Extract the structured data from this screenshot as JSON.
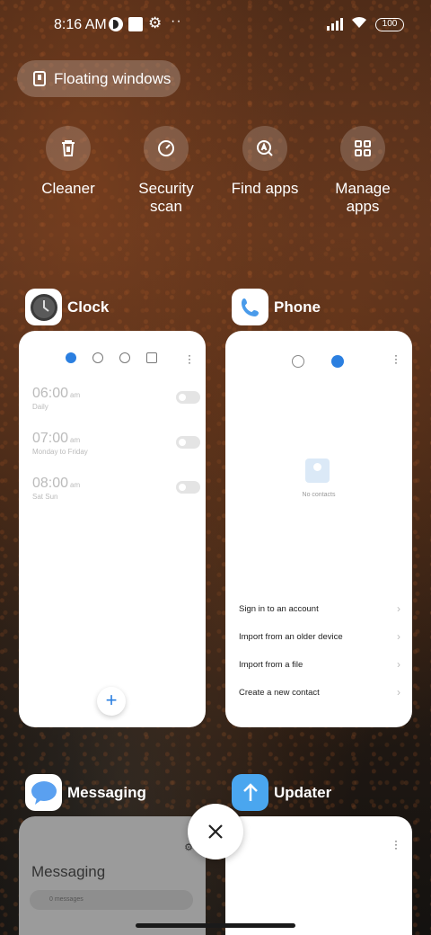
{
  "status_bar": {
    "time": "8:16 AM",
    "battery": "100",
    "icons": [
      "vpn-icon",
      "square-icon",
      "gear-icon",
      "dots-icon",
      "signal-icon",
      "wifi-icon",
      "battery-icon"
    ]
  },
  "floating_windows": {
    "label": "Floating windows",
    "icon": "window-icon"
  },
  "quick_actions": [
    {
      "label": "Cleaner",
      "icon": "trash-icon"
    },
    {
      "label": "Security scan",
      "icon": "security-icon"
    },
    {
      "label": "Find apps",
      "icon": "find-apps-icon"
    },
    {
      "label": "Manage apps",
      "icon": "grid-icon"
    }
  ],
  "apps": {
    "clock": {
      "name": "Clock",
      "alarms": [
        {
          "time": "06:00",
          "ampm": "am",
          "repeat": "Daily",
          "enabled": false
        },
        {
          "time": "07:00",
          "ampm": "am",
          "repeat": "Monday to Friday",
          "enabled": false
        },
        {
          "time": "08:00",
          "ampm": "am",
          "repeat": "Sat Sun",
          "enabled": false
        }
      ],
      "add_label": "+"
    },
    "phone": {
      "name": "Phone",
      "empty_text": "No contacts",
      "options": [
        "Sign in to an account",
        "Import from an older device",
        "Import from a file",
        "Create a new contact"
      ]
    },
    "messaging": {
      "name": "Messaging",
      "title": "Messaging",
      "search_placeholder": "0 messages"
    },
    "updater": {
      "name": "Updater"
    }
  },
  "colors": {
    "accent": "#2b7fe0",
    "card_bg": "#ffffff"
  }
}
